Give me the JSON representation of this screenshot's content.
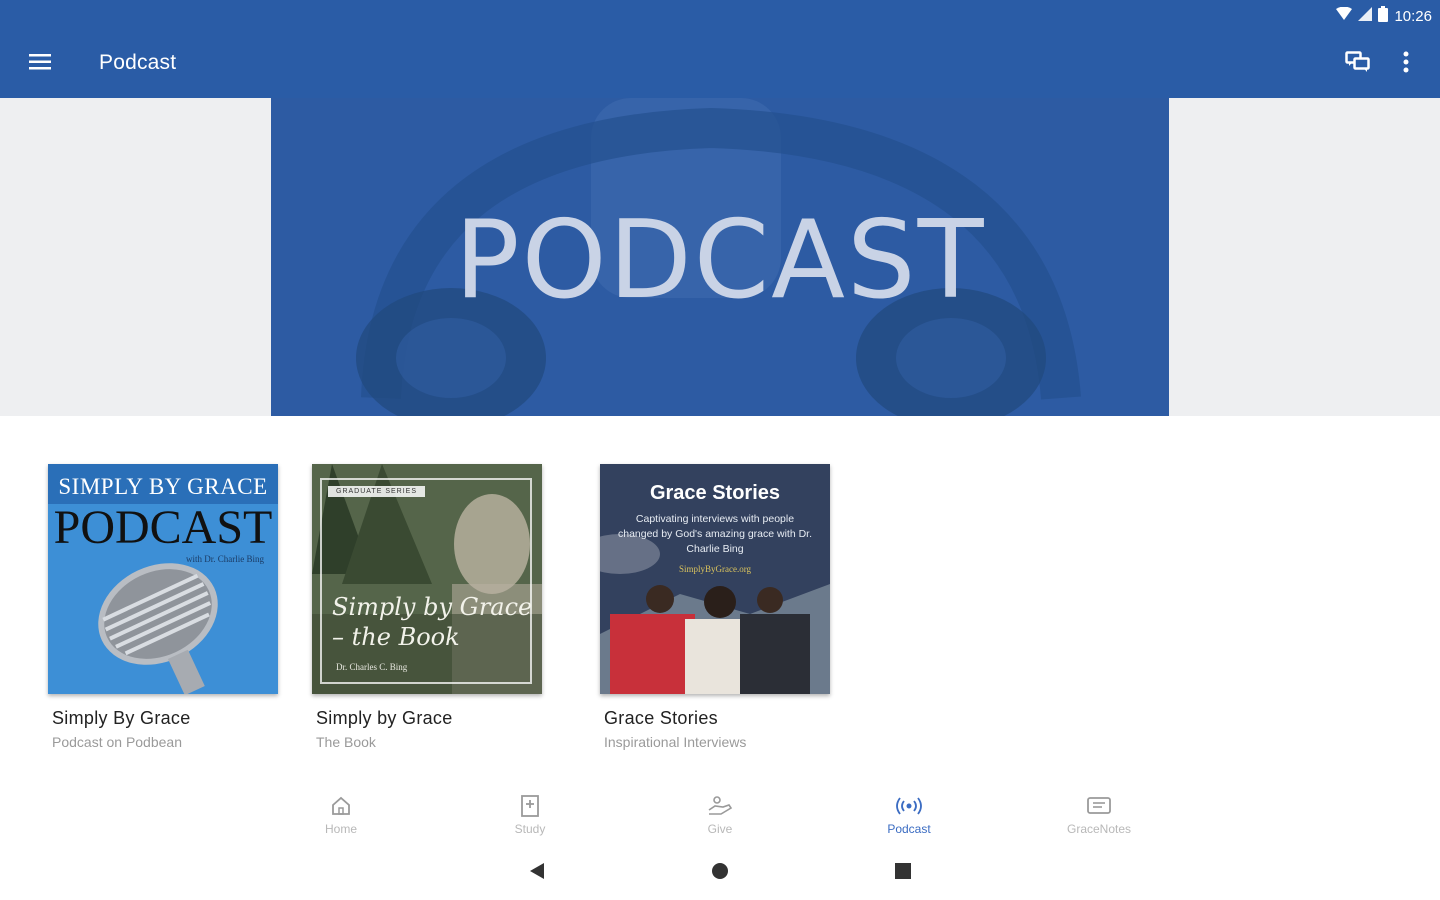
{
  "status_bar": {
    "time": "10:26"
  },
  "app_bar": {
    "title": "Podcast"
  },
  "banner": {
    "title": "PODCAST"
  },
  "cards": [
    {
      "title": "Simply By Grace",
      "subtitle": "Podcast on Podbean",
      "art": {
        "top": "SIMPLY BY GRACE",
        "big": "PODCAST",
        "small": "with Dr. Charlie Bing"
      }
    },
    {
      "title": "Simply by Grace",
      "subtitle": "The Book",
      "art": {
        "tag": "GRADUATE SERIES",
        "script": "Simply by Grace – the Book",
        "author": "Dr. Charles C. Bing"
      }
    },
    {
      "title": "Grace Stories",
      "subtitle": "Inspirational Interviews",
      "art": {
        "heading": "Grace Stories",
        "text": "Captivating interviews with people changed by God's amazing grace with Dr. Charlie Bing",
        "site": "SimplyByGrace.org"
      }
    }
  ],
  "bottom_nav": [
    {
      "label": "Home",
      "icon": "home-icon"
    },
    {
      "label": "Study",
      "icon": "book-icon"
    },
    {
      "label": "Give",
      "icon": "give-icon"
    },
    {
      "label": "Podcast",
      "icon": "podcast-icon",
      "active": true
    },
    {
      "label": "GraceNotes",
      "icon": "notes-icon"
    }
  ],
  "colors": {
    "primary": "#2a5ca6",
    "accent": "#3b6cc2",
    "inactive": "#b8b8b8"
  }
}
